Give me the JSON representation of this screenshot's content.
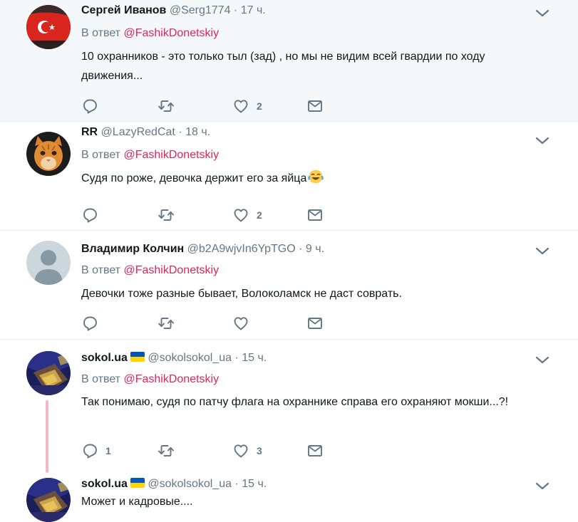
{
  "reply_prefix": "В ответ",
  "tweets": [
    {
      "name": "Сергей Иванов",
      "handle": "@Serg1774",
      "time": "17 ч.",
      "reply_to": "@FashikDonetskiy",
      "text": "10 охранников - это только тыл (зад) , но мы не видим всей гвардии по ходу движения...",
      "likes": "2",
      "avatar": "turkish-flag-car"
    },
    {
      "name": "RR",
      "handle": "@LazyRedCat",
      "time": "18 ч.",
      "reply_to": "@FashikDonetskiy",
      "text": "Судя по роже, девочка держит его за яйца",
      "emoji": "tears-of-joy-emoji",
      "likes": "2",
      "avatar": "ginger-cat"
    },
    {
      "name": "Владимир Колчин",
      "handle": "@b2A9wjvIn6YpTGO",
      "time": "9 ч.",
      "reply_to": "@FashikDonetskiy",
      "text": "Девочки тоже разные бывает, Волоколамск не даст соврать.",
      "avatar": "default-silhouette"
    },
    {
      "name": "sokol.ua",
      "flag": "ukraine-flag-emoji",
      "handle": "@sokolsokol_ua",
      "time": "15 ч.",
      "reply_to": "@FashikDonetskiy",
      "text": "Так понимаю, судя по патчу флага на охраннике справа его охраняют мокши...?!",
      "replies": "1",
      "likes": "3",
      "avatar": "blue-yellow-photo"
    },
    {
      "name": "sokol.ua",
      "flag": "ukraine-flag-emoji",
      "handle": "@sokolsokol_ua",
      "time": "15 ч.",
      "text": "Может и кадровые....",
      "avatar": "blue-yellow-photo"
    }
  ],
  "colors": {
    "mention": "#e0245e",
    "muted": "#657786",
    "highlight_bg": "#f5f8fa",
    "thread_line": "#f4b8c4"
  }
}
